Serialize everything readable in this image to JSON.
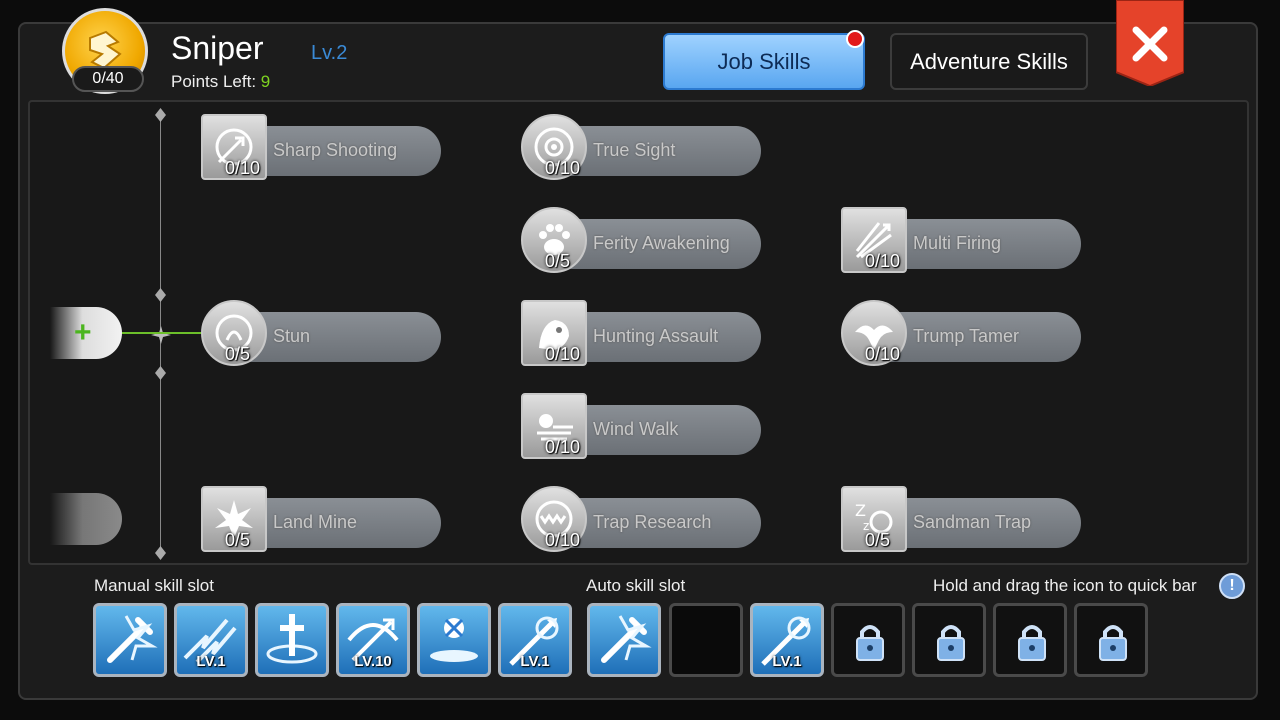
{
  "header": {
    "class_name": "Sniper",
    "class_level": "Lv.2",
    "points_label": "Points Left: ",
    "points_left": "9",
    "emblem_points": "0/40",
    "emblem_icon": "sniper-emblem-icon"
  },
  "tabs": {
    "job": "Job Skills",
    "adventure": "Adventure Skills",
    "job_has_notification": true
  },
  "tree": {
    "skills": [
      {
        "id": "sharp-shooting",
        "name": "Sharp Shooting",
        "level": "0/10",
        "icon": "arrow-target-icon"
      },
      {
        "id": "true-sight",
        "name": "True Sight",
        "level": "0/10",
        "icon": "eye-target-icon"
      },
      {
        "id": "ferity-awakening",
        "name": "Ferity Awakening",
        "level": "0/5",
        "icon": "paw-icon"
      },
      {
        "id": "multi-firing",
        "name": "Multi Firing",
        "level": "0/10",
        "icon": "multi-arrow-icon"
      },
      {
        "id": "stun",
        "name": "Stun",
        "level": "0/5",
        "icon": "stun-icon"
      },
      {
        "id": "hunting-assault",
        "name": "Hunting Assault",
        "level": "0/10",
        "icon": "beast-icon"
      },
      {
        "id": "trump-tamer",
        "name": "Trump Tamer",
        "level": "0/10",
        "icon": "eagle-icon"
      },
      {
        "id": "wind-walk",
        "name": "Wind Walk",
        "level": "0/10",
        "icon": "wind-icon"
      },
      {
        "id": "land-mine",
        "name": "Land Mine",
        "level": "0/5",
        "icon": "explosion-icon"
      },
      {
        "id": "trap-research",
        "name": "Trap Research",
        "level": "0/10",
        "icon": "trap-icon"
      },
      {
        "id": "sandman-trap",
        "name": "Sandman Trap",
        "level": "0/5",
        "icon": "sleep-icon"
      }
    ]
  },
  "slots": {
    "manual_label": "Manual skill slot",
    "auto_label": "Auto skill slot",
    "hint": "Hold and drag the icon to quick bar",
    "manual": [
      {
        "icon": "sword-strike-icon",
        "level": ""
      },
      {
        "icon": "lightning-arrows-icon",
        "level": "LV.1"
      },
      {
        "icon": "holy-cross-icon",
        "level": ""
      },
      {
        "icon": "crossbow-icon",
        "level": "LV.10"
      },
      {
        "icon": "rest-icon",
        "level": ""
      },
      {
        "icon": "piercing-arrow-icon",
        "level": "LV.1"
      }
    ],
    "auto": [
      {
        "icon": "sword-strike-icon",
        "level": "",
        "state": "filled"
      },
      {
        "icon": "",
        "level": "",
        "state": "empty"
      },
      {
        "icon": "piercing-arrow-icon",
        "level": "LV.1",
        "state": "filled"
      },
      {
        "icon": "lock-icon",
        "level": "",
        "state": "locked"
      },
      {
        "icon": "lock-icon",
        "level": "",
        "state": "locked"
      },
      {
        "icon": "lock-icon",
        "level": "",
        "state": "locked"
      },
      {
        "icon": "lock-icon",
        "level": "",
        "state": "locked"
      }
    ]
  },
  "colors": {
    "accent_blue": "#59a6f0",
    "level_blue": "#3a8ad6",
    "points_green": "#7ed321",
    "close_red": "#e5432a"
  }
}
